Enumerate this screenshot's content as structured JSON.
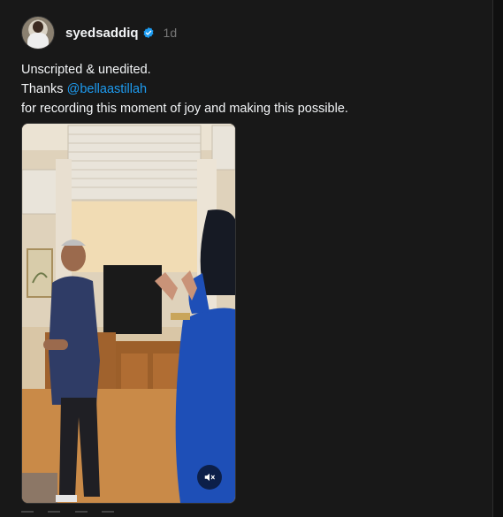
{
  "post": {
    "username": "syedsaddiq",
    "verified": true,
    "time": "1d",
    "caption": {
      "line1": "Unscripted & unedited.",
      "line2_prefix": "Thanks ",
      "mention": "@bellaastillah",
      "line3": "for recording this moment of joy and making this possible."
    },
    "media": {
      "kind": "video",
      "muted": true,
      "mute_icon": "speaker-muted-icon"
    }
  },
  "colors": {
    "background": "#181818",
    "text": "#f3f5f7",
    "muted_text": "#777777",
    "link": "#1d9bf0",
    "verified_badge": "#1d9bf0"
  }
}
